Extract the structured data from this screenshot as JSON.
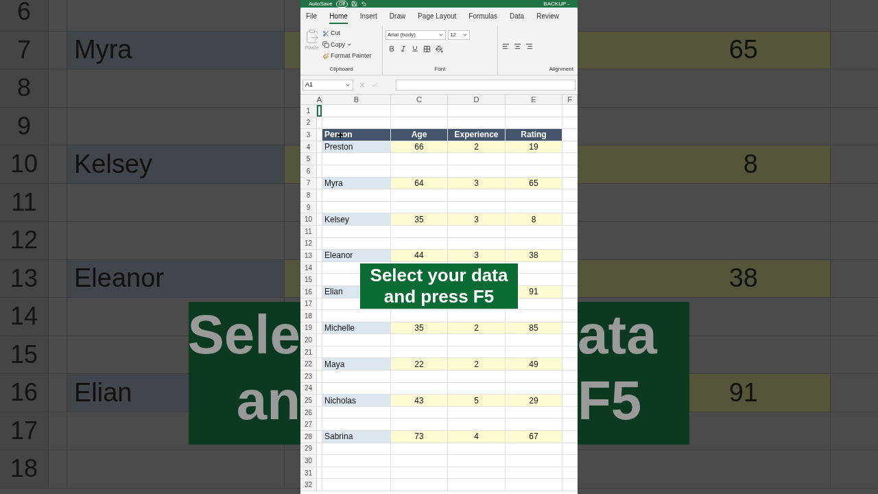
{
  "backdrop_left": {
    "rows": [
      {
        "number": "6"
      },
      {
        "number": "7",
        "name": "Myra"
      },
      {
        "number": "8"
      },
      {
        "number": "9"
      },
      {
        "number": "10",
        "name": "Kelsey"
      },
      {
        "number": "11"
      },
      {
        "number": "12"
      },
      {
        "number": "13",
        "name": "Eleanor"
      },
      {
        "number": "14"
      },
      {
        "number": "15"
      },
      {
        "number": "16",
        "name": "Elian"
      },
      {
        "number": "17"
      },
      {
        "number": "18"
      }
    ],
    "caption_lines": [
      "Sele",
      "an"
    ]
  },
  "backdrop_right": {
    "rows": [
      {},
      {
        "value": "65"
      },
      {},
      {},
      {
        "value": "8"
      },
      {},
      {},
      {
        "value": "38"
      },
      {},
      {},
      {
        "value": "91"
      },
      {},
      {}
    ],
    "caption_lines": [
      "ata",
      "F5"
    ]
  },
  "excel": {
    "title_bar": {
      "autosave_label": "AutoSave",
      "autosave_state": "Off",
      "autosave_on": false,
      "file_name": "BACKUP -"
    },
    "tabs": [
      {
        "label": "File",
        "selected": false
      },
      {
        "label": "Home",
        "selected": true
      },
      {
        "label": "Insert",
        "selected": false
      },
      {
        "label": "Draw",
        "selected": false
      },
      {
        "label": "Page Layout",
        "selected": false
      },
      {
        "label": "Formulas",
        "selected": false
      },
      {
        "label": "Data",
        "selected": false
      },
      {
        "label": "Review",
        "selected": false
      }
    ],
    "ribbon": {
      "paste": "Paste",
      "cut": "Cut",
      "copy": "Copy",
      "format_painter": "Format Painter",
      "clipboard_label": "Clipboard",
      "font_name": "Arial (body)",
      "font_size": "12",
      "font_label": "Font",
      "alignment_label": "Alignment"
    },
    "formula_bar": {
      "name_box": "A1"
    },
    "columns": [
      "A",
      "B",
      "C",
      "D",
      "E",
      "F"
    ],
    "header": [
      "Person",
      "Age",
      "Experience",
      "Rating"
    ],
    "rows": [
      {
        "number": "1"
      },
      {
        "number": "2"
      },
      {
        "number": "3",
        "kind": "header"
      },
      {
        "number": "4",
        "kind": "data",
        "person": "Preston",
        "age": "66",
        "experience": "2",
        "rating": "19"
      },
      {
        "number": "5"
      },
      {
        "number": "6"
      },
      {
        "number": "7",
        "kind": "data",
        "person": "Myra",
        "age": "64",
        "experience": "3",
        "rating": "65"
      },
      {
        "number": "8"
      },
      {
        "number": "9"
      },
      {
        "number": "10",
        "kind": "data",
        "person": "Kelsey",
        "age": "35",
        "experience": "3",
        "rating": "8"
      },
      {
        "number": "11"
      },
      {
        "number": "12"
      },
      {
        "number": "13",
        "kind": "data",
        "person": "Eleanor",
        "age": "44",
        "experience": "3",
        "rating": "38"
      },
      {
        "number": "14"
      },
      {
        "number": "15"
      },
      {
        "number": "16",
        "kind": "data",
        "person": "Elian",
        "rating": "91"
      },
      {
        "number": "17"
      },
      {
        "number": "18"
      },
      {
        "number": "19",
        "kind": "data",
        "person": "Michelle",
        "age": "35",
        "experience": "2",
        "rating": "85"
      },
      {
        "number": "20"
      },
      {
        "number": "21"
      },
      {
        "number": "22",
        "kind": "data",
        "person": "Maya",
        "age": "22",
        "experience": "2",
        "rating": "49"
      },
      {
        "number": "23"
      },
      {
        "number": "24"
      },
      {
        "number": "25",
        "kind": "data",
        "person": "Nicholas",
        "age": "43",
        "experience": "5",
        "rating": "29"
      },
      {
        "number": "26"
      },
      {
        "number": "27"
      },
      {
        "number": "28",
        "kind": "data",
        "person": "Sabrina",
        "age": "73",
        "experience": "4",
        "rating": "67"
      },
      {
        "number": "29"
      },
      {
        "number": "30"
      },
      {
        "number": "31"
      },
      {
        "number": "32"
      }
    ],
    "caption": [
      "Select your data",
      "and press F5"
    ]
  }
}
